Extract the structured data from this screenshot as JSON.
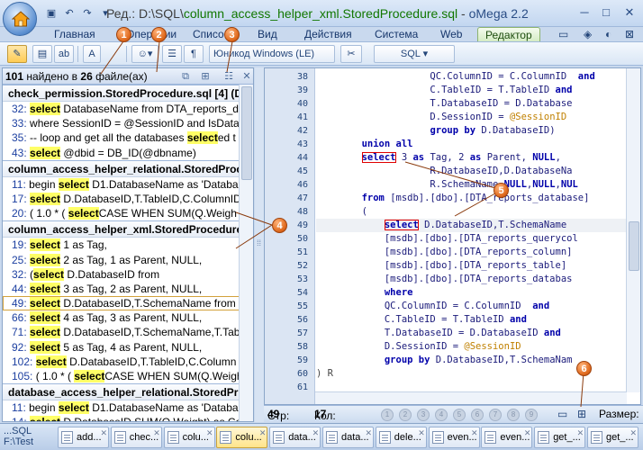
{
  "titlebar": {
    "prefix": "Ред.: ",
    "path": "D:\\SQL\\",
    "filename": "column_access_helper_xml.StoredProcedure.sql",
    "sep": " - ",
    "app": "oMega 2.2"
  },
  "ribbon_tabs": [
    "Главная",
    "Операции",
    "Списо",
    "Вид",
    "Действия",
    "Система",
    "Web",
    "Редактор"
  ],
  "active_tab": "Редактор",
  "toolbar": {
    "encoding": "Юникод Windows (LE)",
    "syntax": "SQL"
  },
  "results": {
    "summary_count": "101",
    "summary_mid": " найдено в ",
    "summary_files": "26",
    "summary_tail": " файле(ах)",
    "groups": [
      {
        "title": "check_permission.StoredProcedure.sql [4] (D",
        "hits": [
          {
            "ln": "32:",
            "pre": " ",
            "kw": "select",
            "post": " DatabaseName from DTA_reports_d"
          },
          {
            "ln": "33:",
            "pre": " where SessionID = @SessionID and IsDataba",
            "kw": "",
            "post": ""
          },
          {
            "ln": "35:",
            "pre": " -- loop and get all the databases ",
            "kw": "select",
            "post": "ed t"
          },
          {
            "ln": "43:",
            "pre": " ",
            "kw": "select",
            "post": "  @dbid = DB_ID(@dbname)"
          }
        ]
      },
      {
        "title": "column_access_helper_relational.StoredProc",
        "hits": [
          {
            "ln": "11:",
            "pre": " begin ",
            "kw": "select",
            "post": " D1.DatabaseName as 'Databa"
          },
          {
            "ln": "17:",
            "pre": " ",
            "kw": "select",
            "post": " D.DatabaseID,T.TableID,C.ColumnID"
          },
          {
            "ln": "20:",
            "pre": " ( 1.0 * (  ",
            "kw": "select",
            "post": "CASE WHEN SUM(Q.Weigh"
          }
        ]
      },
      {
        "title": "column_access_helper_xml.StoredProcedure.s",
        "hits": [
          {
            "ln": "19:",
            "pre": " ",
            "kw": "select",
            "post": " 1         as Tag,"
          },
          {
            "ln": "25:",
            "pre": " ",
            "kw": "select",
            "post": " 2 as Tag, 1 as Parent, NULL,"
          },
          {
            "ln": "32:",
            "pre": " (",
            "kw": "select",
            "post": " D.DatabaseID from"
          },
          {
            "ln": "44:",
            "pre": " ",
            "kw": "select",
            "post": " 3 as Tag, 2 as Parent, NULL,"
          },
          {
            "ln": "49:",
            "pre": " ",
            "kw": "select",
            "post": " D.DatabaseID,T.SchemaName from"
          },
          {
            "ln": "66:",
            "pre": " ",
            "kw": "select",
            "post": " 4 as Tag, 3 as Parent, NULL,"
          },
          {
            "ln": "71:",
            "pre": " ",
            "kw": "select",
            "post": " D.DatabaseID,T.SchemaName,T.Tabl"
          },
          {
            "ln": "92:",
            "pre": " ",
            "kw": "select",
            "post": " 5 as Tag, 4 as Parent, NULL,"
          },
          {
            "ln": "102:",
            "pre": " ",
            "kw": "select",
            "post": " D.DatabaseID,T.TableID,C.Column"
          },
          {
            "ln": "105:",
            "pre": " ( 1.0 * (  ",
            "kw": "select",
            "post": "CASE WHEN SUM(Q.Weigh"
          }
        ]
      },
      {
        "title": "database_access_helper_relational.StoredProc",
        "hits": [
          {
            "ln": "11:",
            "pre": " begin ",
            "kw": "select",
            "post": " D1.DatabaseName as 'Databa"
          },
          {
            "ln": "14:",
            "pre": " ",
            "kw": "select",
            "post": " D.DatabaseID,SUM(Q.Weight) as Co"
          },
          {
            "ln": "16:",
            "pre": " ( 1.0 * (  ",
            "kw": "select",
            "post": "CASE WHEN SUM(Q.Weigh"
          }
        ]
      }
    ]
  },
  "editor": {
    "lines": [
      {
        "no": "38",
        "code": [
          {
            "t": "                    QC.ColumnID = C.ColumnID  ",
            "c": "n"
          },
          {
            "t": "and",
            "c": "k"
          }
        ]
      },
      {
        "no": "39",
        "code": [
          {
            "t": "                    C.TableID = T.TableID ",
            "c": "n"
          },
          {
            "t": "and",
            "c": "k"
          }
        ]
      },
      {
        "no": "40",
        "code": [
          {
            "t": "                    T.DatabaseID = D.Database",
            "c": "n"
          }
        ]
      },
      {
        "no": "41",
        "code": [
          {
            "t": "                    D.SessionID = ",
            "c": "n"
          },
          {
            "t": "@SessionID",
            "c": "v"
          }
        ]
      },
      {
        "no": "42",
        "code": [
          {
            "t": "                    ",
            "c": "n"
          },
          {
            "t": "group by",
            "c": "k"
          },
          {
            "t": " D.DatabaseID)",
            "c": "n"
          }
        ]
      },
      {
        "no": "43",
        "code": [
          {
            "t": "        ",
            "c": "n"
          },
          {
            "t": "union all",
            "c": "k"
          }
        ]
      },
      {
        "no": "44",
        "code": [
          {
            "t": "        ",
            "c": "n"
          },
          {
            "t": "select",
            "c": "k",
            "box": true
          },
          {
            "t": " 3 ",
            "c": "n"
          },
          {
            "t": "as",
            "c": "k"
          },
          {
            "t": " Tag, 2 ",
            "c": "n"
          },
          {
            "t": "as",
            "c": "k"
          },
          {
            "t": " Parent, ",
            "c": "n"
          },
          {
            "t": "NULL",
            "c": "k"
          },
          {
            "t": ",",
            "c": "n"
          }
        ]
      },
      {
        "no": "45",
        "code": [
          {
            "t": "                    R.DatabaseID,D.DatabaseNa",
            "c": "n"
          }
        ]
      },
      {
        "no": "46",
        "code": [
          {
            "t": "                    R.SchemaName,",
            "c": "n"
          },
          {
            "t": "NULL",
            "c": "k"
          },
          {
            "t": ",",
            "c": "n"
          },
          {
            "t": "NULL",
            "c": "k"
          },
          {
            "t": ",",
            "c": "n"
          },
          {
            "t": "NUL",
            "c": "k"
          }
        ]
      },
      {
        "no": "47",
        "code": [
          {
            "t": "        ",
            "c": "n"
          },
          {
            "t": "from",
            "c": "k"
          },
          {
            "t": " [msdb].[dbo].[DTA_reports_database]",
            "c": "n"
          }
        ]
      },
      {
        "no": "48",
        "code": [
          {
            "t": "        (",
            "c": "n"
          }
        ]
      },
      {
        "no": "49",
        "code": [
          {
            "t": "            ",
            "c": "n"
          },
          {
            "t": "select",
            "c": "k",
            "box": true
          },
          {
            "t": " D.DatabaseID,T.SchemaName",
            "c": "n"
          }
        ],
        "current": true
      },
      {
        "no": "50",
        "code": [
          {
            "t": "            [msdb].[dbo].[DTA_reports_querycol",
            "c": "n"
          }
        ]
      },
      {
        "no": "51",
        "code": [
          {
            "t": "            [msdb].[dbo].[DTA_reports_column]",
            "c": "n"
          }
        ]
      },
      {
        "no": "52",
        "code": [
          {
            "t": "            [msdb].[dbo].[DTA_reports_table]",
            "c": "n"
          }
        ]
      },
      {
        "no": "53",
        "code": [
          {
            "t": "            [msdb].[dbo].[DTA_reports_databas",
            "c": "n"
          }
        ]
      },
      {
        "no": "54",
        "code": [
          {
            "t": "            ",
            "c": "n"
          },
          {
            "t": "where",
            "c": "k"
          }
        ]
      },
      {
        "no": "55",
        "code": [
          {
            "t": "            QC.ColumnID = C.ColumnID  ",
            "c": "n"
          },
          {
            "t": "and",
            "c": "k"
          }
        ]
      },
      {
        "no": "56",
        "code": [
          {
            "t": "            C.TableID = T.TableID ",
            "c": "n"
          },
          {
            "t": "and",
            "c": "k"
          }
        ]
      },
      {
        "no": "57",
        "code": [
          {
            "t": "            T.DatabaseID = D.DatabaseID ",
            "c": "n"
          },
          {
            "t": "and",
            "c": "k"
          }
        ]
      },
      {
        "no": "58",
        "code": [
          {
            "t": "            D.SessionID = ",
            "c": "n"
          },
          {
            "t": "@SessionID",
            "c": "v"
          }
        ]
      },
      {
        "no": "59",
        "code": [
          {
            "t": "            ",
            "c": "n"
          },
          {
            "t": "group by",
            "c": "k"
          },
          {
            "t": " D.DatabaseID,T.SchemaNam",
            "c": "n"
          }
        ]
      },
      {
        "no": "60",
        "code": [
          {
            "t": ") R",
            "c": "p"
          }
        ]
      },
      {
        "no": "61",
        "code": []
      }
    ]
  },
  "status": {
    "row_label": "Стр:",
    "row_value": "49",
    "col_label": "Кол:",
    "col_value": "17",
    "bookmarks": [
      "1",
      "2",
      "3",
      "4",
      "5",
      "6",
      "7",
      "8",
      "9"
    ],
    "size_label": "Размер:"
  },
  "doctabs": {
    "first_line1": "...SQL",
    "first_line2": "F:\\Test",
    "tabs": [
      "add...",
      "chec...",
      "colu...",
      "colu...",
      "data...",
      "data...",
      "dele...",
      "even...",
      "even...",
      "get_...",
      "get_..."
    ],
    "active_index": 3
  },
  "callouts": [
    "1",
    "2",
    "3",
    "4",
    "5",
    "6"
  ]
}
